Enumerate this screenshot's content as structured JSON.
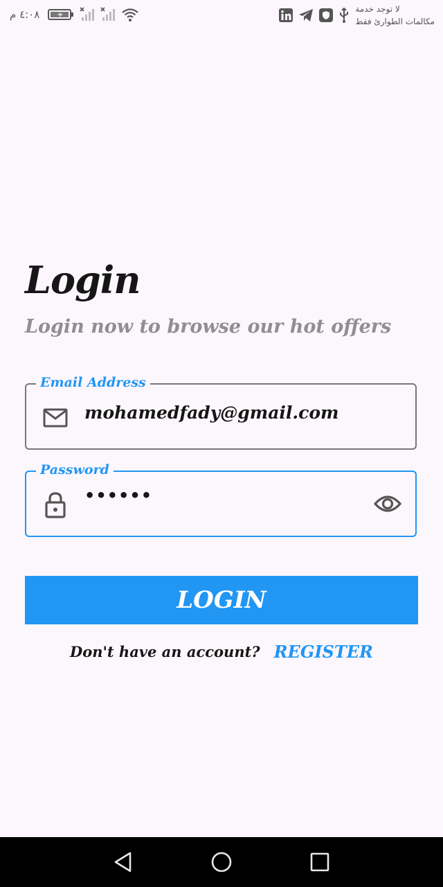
{
  "status_bar": {
    "time": "٤:٠٨ م",
    "carrier_line1": "لا توجد خدمة",
    "carrier_line2": "مكالمات الطوارئ فقط"
  },
  "login": {
    "title": "Login",
    "subtitle": "Login now to browse our hot offers"
  },
  "email_field": {
    "label": "Email Address",
    "value": "mohamedfady@gmail.com"
  },
  "password_field": {
    "label": "Password",
    "value": "••••••"
  },
  "login_button": {
    "label": "LOGIN"
  },
  "register": {
    "prompt": "Don't have an account?",
    "link": "REGISTER"
  },
  "colors": {
    "accent": "#2196f3",
    "background": "#fcf7fc",
    "text": "#161616",
    "muted": "#8f8f8f",
    "nav_bar": "#000000"
  },
  "icons": {
    "email": "mail-icon",
    "password": "lock-icon",
    "toggle": "eye-icon"
  }
}
